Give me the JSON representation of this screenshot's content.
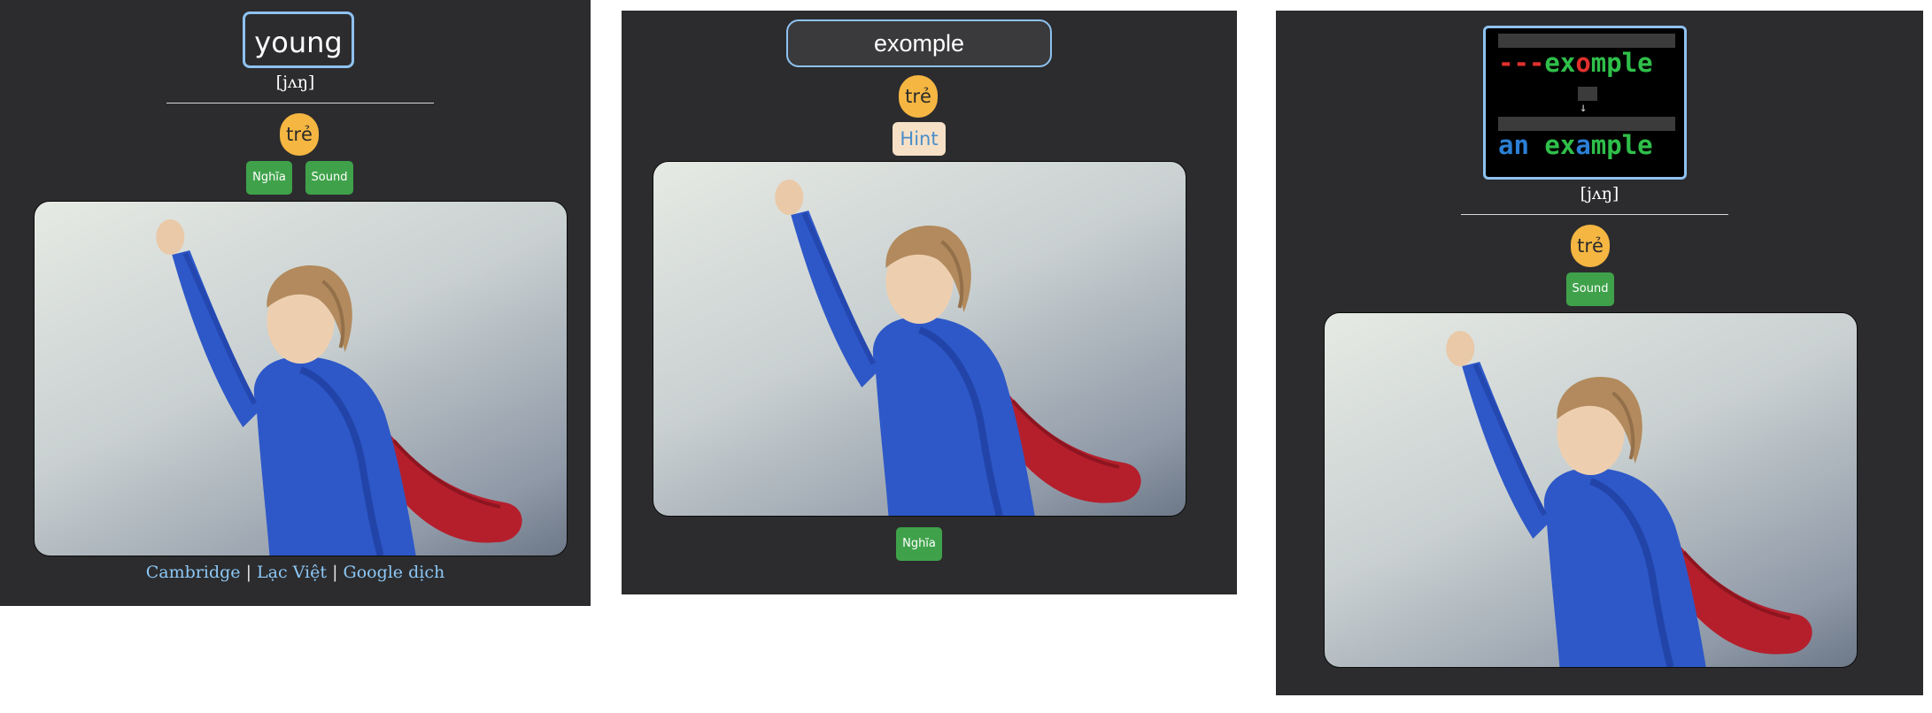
{
  "panel1": {
    "word": "young",
    "ipa": "[jʌŋ]",
    "meaning": "trẻ",
    "buttons": {
      "meaning": "Nghĩa",
      "sound": "Sound"
    },
    "links": {
      "cambridge": "Cambridge",
      "lacviet": "Lạc Việt",
      "google": "Google dịch",
      "separator": "|"
    }
  },
  "panel2": {
    "word_value": "exomple",
    "meaning": "trẻ",
    "hint": "Hint",
    "buttons": {
      "meaning": "Nghĩa"
    }
  },
  "panel3": {
    "diff": {
      "typed_prefix": "---",
      "typed_a": "ex",
      "typed_error": "o",
      "typed_b": "mple",
      "arrow": "↓",
      "correct_a": "an",
      "correct_b": "ex",
      "correct_fix": "a",
      "correct_c": "mple"
    },
    "ipa": "[jʌŋ]",
    "meaning": "trẻ",
    "buttons": {
      "sound": "Sound"
    }
  },
  "colors": {
    "panel_bg": "#2c2c2e",
    "meaning_pill": "#f5b642",
    "button_green": "#3fa24a",
    "focus_border": "#8ec2f0",
    "link": "#8cc8f7",
    "diff_red": "#e0302c",
    "diff_green": "#2fbf4a",
    "diff_blue": "#2b7fd6"
  }
}
